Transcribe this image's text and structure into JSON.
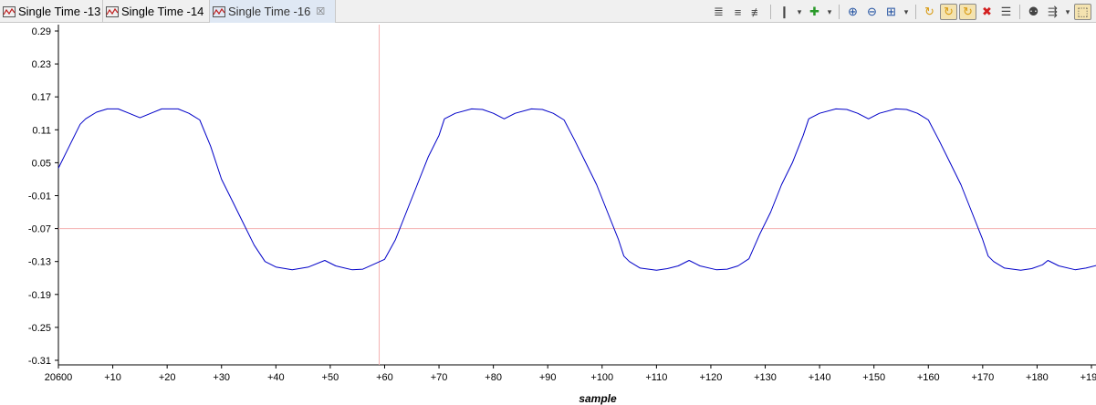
{
  "tabs": [
    {
      "label": "Single Time -13",
      "icon": "waveform-icon",
      "active": false
    },
    {
      "label": "Single Time -14",
      "icon": "waveform-icon",
      "active": false
    },
    {
      "label": "Single Time -16",
      "icon": "waveform-icon",
      "active": true,
      "close_glyph": "☒"
    }
  ],
  "toolbar": [
    {
      "name": "align-left-icon",
      "glyph": "≣"
    },
    {
      "name": "align-center-icon",
      "glyph": "≡"
    },
    {
      "name": "align-right-icon",
      "glyph": "≢"
    },
    {
      "name": "marker-icon",
      "glyph": "❙"
    },
    {
      "name": "marker-dropdown-icon",
      "glyph": "▾"
    },
    {
      "name": "add-icon",
      "glyph": "✚"
    },
    {
      "name": "add-dropdown-icon",
      "glyph": "▾"
    },
    {
      "name": "zoom-in-icon",
      "glyph": "⊕"
    },
    {
      "name": "zoom-out-icon",
      "glyph": "⊖"
    },
    {
      "name": "zoom-fit-icon",
      "glyph": "⊞"
    },
    {
      "name": "zoom-dropdown-icon",
      "glyph": "▾"
    },
    {
      "name": "refresh-icon",
      "glyph": "↻"
    },
    {
      "name": "auto-refresh-icon",
      "glyph": "↻"
    },
    {
      "name": "continuous-refresh-icon",
      "glyph": "↻"
    },
    {
      "name": "delete-icon",
      "glyph": "✖"
    },
    {
      "name": "properties-icon",
      "glyph": "☰"
    },
    {
      "name": "find-icon",
      "glyph": "⚉"
    },
    {
      "name": "export-icon",
      "glyph": "⇶"
    },
    {
      "name": "export-dropdown-icon",
      "glyph": "▾"
    },
    {
      "name": "lock-icon",
      "glyph": "⬚"
    }
  ],
  "colors": {
    "trace": "#0000c8",
    "cursor": "#f4b3b3",
    "axis": "#000000",
    "tab_active": "#dfe8f4",
    "delete": "#d32020",
    "refresh": "#d89a10"
  },
  "chart_data": {
    "type": "line",
    "xlabel": "sample",
    "ylabel": "",
    "x_origin_label": "20600",
    "xlim": [
      0,
      190
    ],
    "ylim": [
      -0.32,
      0.3
    ],
    "yticks": [
      "0.29",
      "0.23",
      "0.17",
      "0.11",
      "0.05",
      "-0.01",
      "-0.07",
      "-0.13",
      "-0.19",
      "-0.25",
      "-0.31"
    ],
    "xticks": [
      "20600",
      "+10",
      "+20",
      "+30",
      "+40",
      "+50",
      "+60",
      "+70",
      "+80",
      "+90",
      "+100",
      "+110",
      "+120",
      "+130",
      "+140",
      "+150",
      "+160",
      "+170",
      "+180",
      "+190"
    ],
    "cursor": {
      "x": 59,
      "y": -0.07
    },
    "series": [
      {
        "values": [
          [
            0,
            0.04
          ],
          [
            2,
            0.08
          ],
          [
            4,
            0.12
          ],
          [
            5,
            0.13
          ],
          [
            7,
            0.142
          ],
          [
            9,
            0.148
          ],
          [
            11,
            0.148
          ],
          [
            13,
            0.14
          ],
          [
            15,
            0.132
          ],
          [
            17,
            0.14
          ],
          [
            19,
            0.148
          ],
          [
            22,
            0.148
          ],
          [
            24,
            0.14
          ],
          [
            26,
            0.128
          ],
          [
            28,
            0.08
          ],
          [
            30,
            0.02
          ],
          [
            32,
            -0.02
          ],
          [
            34,
            -0.06
          ],
          [
            36,
            -0.1
          ],
          [
            38,
            -0.13
          ],
          [
            40,
            -0.14
          ],
          [
            43,
            -0.145
          ],
          [
            46,
            -0.14
          ],
          [
            49,
            -0.128
          ],
          [
            51,
            -0.138
          ],
          [
            54,
            -0.145
          ],
          [
            56,
            -0.144
          ],
          [
            58,
            -0.135
          ],
          [
            60,
            -0.126
          ],
          [
            62,
            -0.09
          ],
          [
            64,
            -0.04
          ],
          [
            66,
            0.01
          ],
          [
            68,
            0.06
          ],
          [
            70,
            0.1
          ],
          [
            71,
            0.13
          ],
          [
            73,
            0.14
          ],
          [
            76,
            0.148
          ],
          [
            78,
            0.147
          ],
          [
            80,
            0.14
          ],
          [
            82,
            0.13
          ],
          [
            84,
            0.14
          ],
          [
            87,
            0.148
          ],
          [
            89,
            0.147
          ],
          [
            91,
            0.14
          ],
          [
            93,
            0.128
          ],
          [
            95,
            0.09
          ],
          [
            97,
            0.05
          ],
          [
            99,
            0.01
          ],
          [
            101,
            -0.04
          ],
          [
            103,
            -0.09
          ],
          [
            104,
            -0.12
          ],
          [
            105,
            -0.13
          ],
          [
            107,
            -0.142
          ],
          [
            110,
            -0.146
          ],
          [
            112,
            -0.143
          ],
          [
            114,
            -0.138
          ],
          [
            116,
            -0.128
          ],
          [
            118,
            -0.138
          ],
          [
            121,
            -0.145
          ],
          [
            123,
            -0.144
          ],
          [
            125,
            -0.138
          ],
          [
            127,
            -0.125
          ],
          [
            129,
            -0.08
          ],
          [
            131,
            -0.04
          ],
          [
            133,
            0.01
          ],
          [
            135,
            0.05
          ],
          [
            137,
            0.1
          ],
          [
            138,
            0.13
          ],
          [
            140,
            0.14
          ],
          [
            143,
            0.148
          ],
          [
            145,
            0.147
          ],
          [
            147,
            0.14
          ],
          [
            149,
            0.13
          ],
          [
            151,
            0.14
          ],
          [
            154,
            0.148
          ],
          [
            156,
            0.147
          ],
          [
            158,
            0.14
          ],
          [
            160,
            0.128
          ],
          [
            162,
            0.09
          ],
          [
            164,
            0.05
          ],
          [
            166,
            0.01
          ],
          [
            168,
            -0.04
          ],
          [
            170,
            -0.09
          ],
          [
            171,
            -0.12
          ],
          [
            172,
            -0.13
          ],
          [
            174,
            -0.142
          ],
          [
            177,
            -0.146
          ],
          [
            179,
            -0.143
          ],
          [
            181,
            -0.136
          ],
          [
            182,
            -0.128
          ],
          [
            184,
            -0.138
          ],
          [
            187,
            -0.145
          ],
          [
            189,
            -0.142
          ],
          [
            191,
            -0.137
          ]
        ]
      }
    ]
  }
}
